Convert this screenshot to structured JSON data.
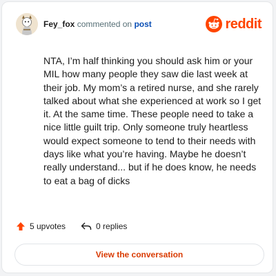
{
  "comment": {
    "author": "Fey_fox",
    "action_text": "commented on",
    "target_text": "post",
    "body": "NTA, I’m half thinking you should ask him or your MIL how many people they saw die last week at their job. My mom’s a retired nurse, and she rarely talked about what she experienced at work so I get it. At the same time. These people need to take a nice little guilt trip. Only someone truly heartless would expect someone to tend to their needs with days like what you’re having. Maybe he doesn’t really understand... but if he does know, he needs to eat a bag of dicks",
    "upvotes_label": "5 upvotes",
    "replies_label": "0 replies"
  },
  "brand": {
    "wordmark": "reddit",
    "color": "#ff4500"
  },
  "cta": {
    "label": "View the conversation"
  },
  "icons": {
    "upvote": "upvote-arrow-icon",
    "reply": "reply-arrow-icon",
    "logo": "reddit-snoo-icon"
  }
}
